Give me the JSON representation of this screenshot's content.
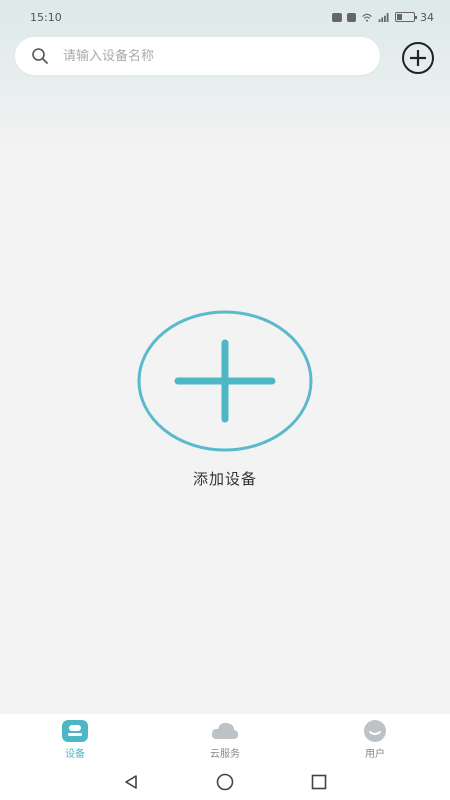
{
  "status_bar": {
    "time": "15:10",
    "battery": "34"
  },
  "search": {
    "placeholder": "请输入设备名称",
    "value": ""
  },
  "main": {
    "add_device_label": "添加设备"
  },
  "tabs": [
    {
      "label": "设备",
      "icon": "device-icon",
      "active": true
    },
    {
      "label": "云服务",
      "icon": "cloud-icon",
      "active": false
    },
    {
      "label": "用户",
      "icon": "user-icon",
      "active": false
    }
  ],
  "colors": {
    "accent": "#4eb7c6",
    "background": "#f3f3f3"
  },
  "system_nav": [
    "back-icon",
    "home-icon",
    "recents-icon"
  ]
}
